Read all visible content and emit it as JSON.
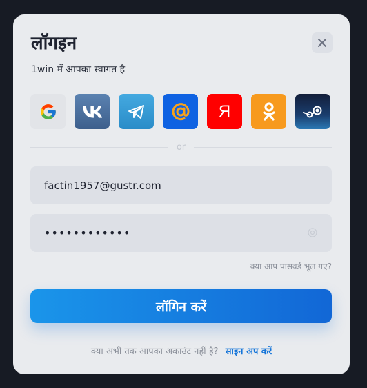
{
  "modal": {
    "title": "लॉगइन",
    "subtitle": "1win में आपका स्वागत है",
    "close_icon": "close-icon"
  },
  "socials": [
    {
      "name": "google",
      "icon": "google-icon"
    },
    {
      "name": "vk",
      "icon": "vk-icon"
    },
    {
      "name": "telegram",
      "icon": "telegram-icon"
    },
    {
      "name": "mail",
      "icon": "mail-at-icon"
    },
    {
      "name": "yandex",
      "icon": "yandex-icon",
      "glyph": "Я"
    },
    {
      "name": "odnoklassniki",
      "icon": "odnoklassniki-icon"
    },
    {
      "name": "steam",
      "icon": "steam-icon"
    }
  ],
  "divider_text": "or",
  "email": {
    "value": "factin1957@gustr.com"
  },
  "password": {
    "value": "••••••••••••",
    "eye_icon": "eye-icon"
  },
  "forgot_label": "क्या आप पासवर्ड भूल गए?",
  "login_label": "लॉगिन करें",
  "signup": {
    "question": "क्या अभी तक आपका अकाउंट नहीं है?",
    "link": "साइन अप करें"
  },
  "colors": {
    "background": "#171b24",
    "modal": "#e9ebee",
    "field": "#dde0e6",
    "accent": "#1575d9"
  }
}
